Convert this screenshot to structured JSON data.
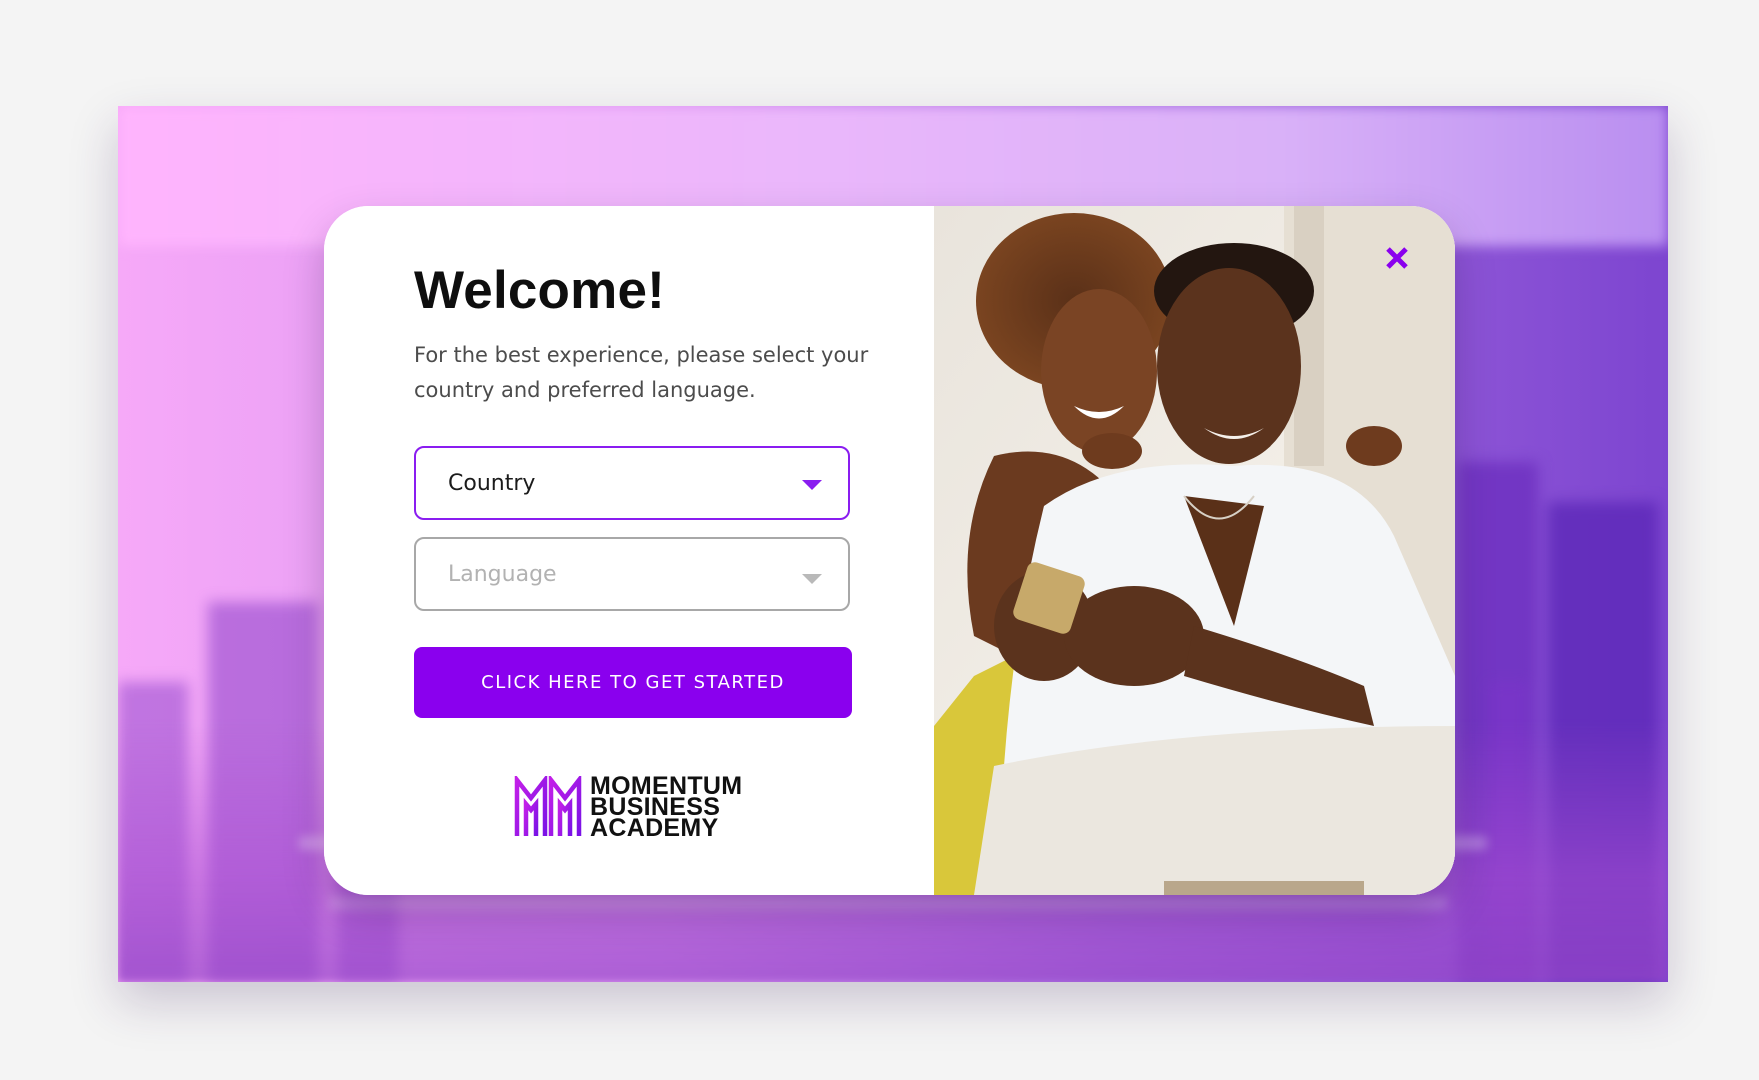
{
  "modal": {
    "title": "Welcome!",
    "subtitle": "For the best experience, please select your country and preferred language.",
    "country_select": {
      "value": "Country",
      "icon": "caret-down-icon"
    },
    "language_select": {
      "value": "Language",
      "icon": "caret-down-icon"
    },
    "cta_label": "CLICK HERE TO GET STARTED",
    "close_icon": "close-icon"
  },
  "logo": {
    "line1": "MOMENTUM",
    "line2": "BUSINESS",
    "line3": "ACADEMY"
  },
  "colors": {
    "accent": "#8a00ee",
    "select_border_active": "#8a1df0",
    "select_border_inactive": "#a8a8a8",
    "title": "#0e0e0e",
    "background": "#f4f4f4"
  }
}
